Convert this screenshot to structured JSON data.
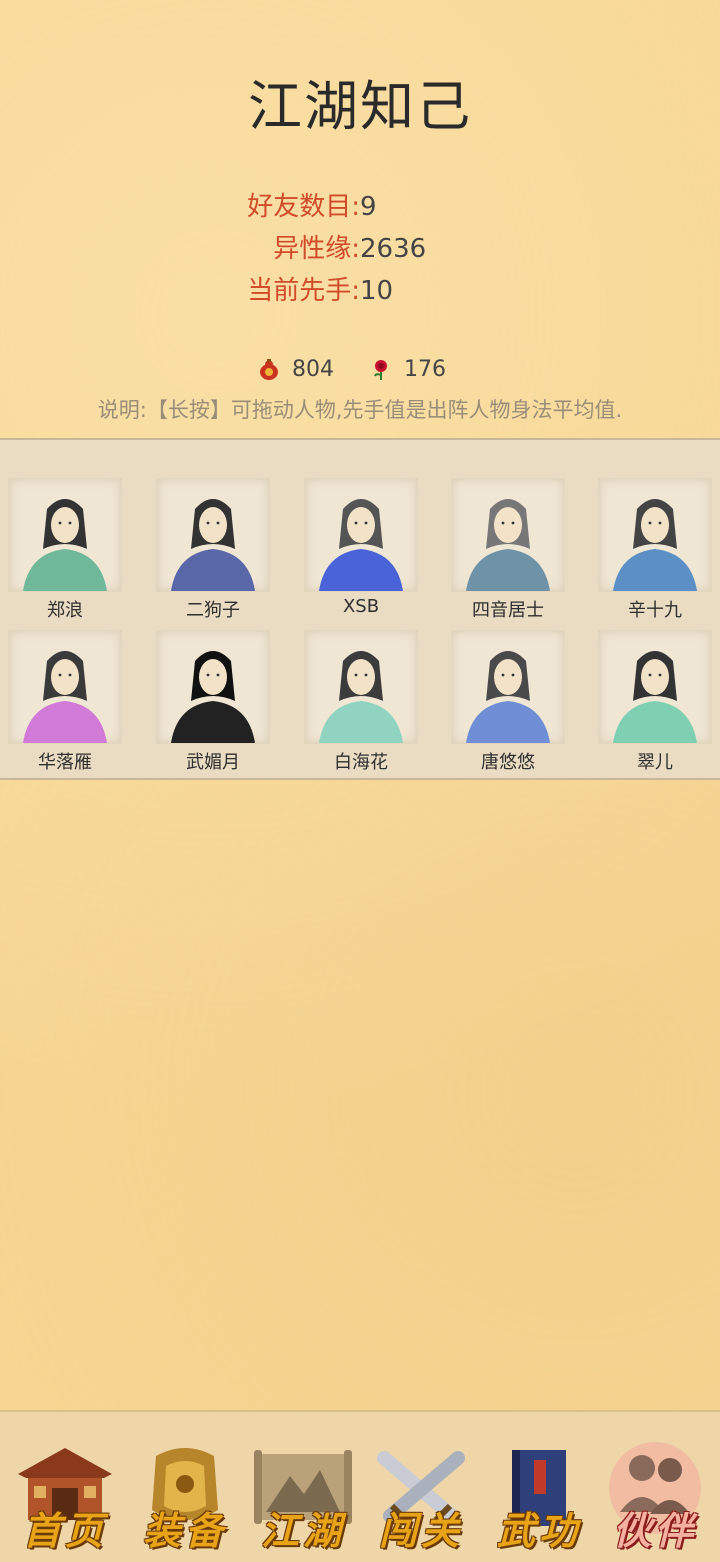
{
  "page": {
    "title": "江湖知己"
  },
  "stats": [
    {
      "label": "好友数目:",
      "value": "9"
    },
    {
      "label": "异性缘:",
      "value": "2636"
    },
    {
      "label": "当前先手:",
      "value": "10"
    }
  ],
  "currency": {
    "gourd": {
      "icon": "gourd-icon",
      "value": "804"
    },
    "rose": {
      "icon": "rose-icon",
      "value": "176"
    }
  },
  "note": "说明:【长按】可拖动人物,先手值是出阵人物身法平均值.",
  "companions": [
    {
      "name": "郑浪",
      "robe": "#6fb89a",
      "hair": "#333"
    },
    {
      "name": "二狗子",
      "robe": "#5a67a8",
      "hair": "#333"
    },
    {
      "name": "XSB",
      "robe": "#4a63d8",
      "hair": "#555"
    },
    {
      "name": "四音居士",
      "robe": "#6f93a6",
      "hair": "#777"
    },
    {
      "name": "辛十九",
      "robe": "#5c8fc6",
      "hair": "#444"
    },
    {
      "name": "华落雁",
      "robe": "#d27ad8",
      "hair": "#3a3a3a"
    },
    {
      "name": "武媚月",
      "robe": "#222222",
      "hair": "#111"
    },
    {
      "name": "白海花",
      "robe": "#8fd3c0",
      "hair": "#3c3c3c"
    },
    {
      "name": "唐悠悠",
      "robe": "#6f8ed6",
      "hair": "#4a4a4a"
    },
    {
      "name": "翠儿",
      "robe": "#7fd0b2",
      "hair": "#333"
    }
  ],
  "nav": [
    {
      "label": "首页",
      "icon": "house-icon"
    },
    {
      "label": "装备",
      "icon": "armor-icon"
    },
    {
      "label": "江湖",
      "icon": "scroll-map-icon"
    },
    {
      "label": "闯关",
      "icon": "crossed-swords-icon"
    },
    {
      "label": "武功",
      "icon": "book-icon"
    },
    {
      "label": "伙伴",
      "icon": "companions-icon",
      "active": true
    }
  ]
}
